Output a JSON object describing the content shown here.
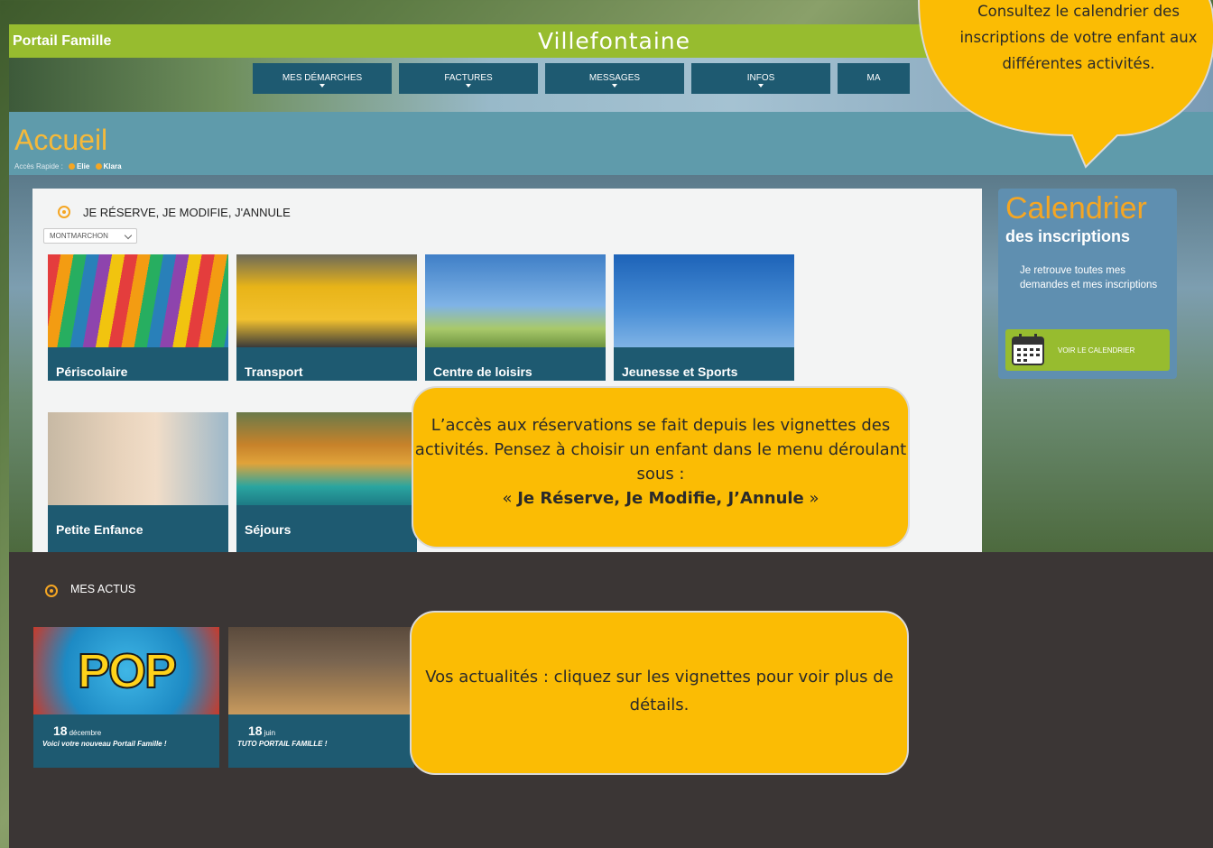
{
  "header": {
    "portal_title": "Portail Famille",
    "logo": "Villefontaine"
  },
  "nav": [
    {
      "label": "MES DÉMARCHES"
    },
    {
      "label": "FACTURES"
    },
    {
      "label": "MESSAGES"
    },
    {
      "label": "INFOS"
    },
    {
      "label": "MA"
    }
  ],
  "page": {
    "title": "Accueil",
    "quick_access_label": "Accès Rapide :",
    "children": [
      "Elie",
      "Klara"
    ]
  },
  "reservations": {
    "section_title": "JE RÉSERVE, JE MODIFIE, J'ANNULE",
    "selected_child": "MONTMARCHON",
    "tiles": [
      {
        "label": "Périscolaire",
        "icon": "colored-pencils-image"
      },
      {
        "label": "Transport",
        "icon": "school-bus-image"
      },
      {
        "label": "Centre de loisirs",
        "icon": "kids-jumping-image"
      },
      {
        "label": "Jeunesse et Sports",
        "icon": "football-player-image"
      },
      {
        "label": "Petite Enfance",
        "icon": "child-with-shell-image"
      },
      {
        "label": "Séjours",
        "icon": "autumn-lake-image"
      }
    ]
  },
  "calendar": {
    "title": "Calendrier",
    "subtitle": "des inscriptions",
    "description": "Je retrouve toutes mes demandes et mes inscriptions",
    "button_label": "VOIR LE CALENDRIER",
    "icon": "calendar-icon"
  },
  "actus": {
    "section_title": "MES ACTUS",
    "items": [
      {
        "day": "18",
        "month": "décembre",
        "caption": "Voici votre nouveau Portail Famille !",
        "image_text": "POP"
      },
      {
        "day": "18",
        "month": "juin",
        "caption": "TUTO PORTAIL FAMILLE !"
      }
    ]
  },
  "callouts": {
    "calendar_tip": "Consultez le calendrier des inscriptions de votre enfant aux différentes activités.",
    "reservation_tip_line1": "L’accès aux réservations se fait depuis les vignettes des activités. Pensez à choisir un enfant dans le menu déroulant sous :",
    "reservation_tip_quote_open": "« ",
    "reservation_tip_bold": "Je Réserve, Je Modifie, J’Annule",
    "reservation_tip_quote_close": " »",
    "actus_tip": "Vos actualités : cliquez sur les vignettes pour voir plus de détails."
  },
  "colors": {
    "header_green": "#97bc2f",
    "nav_blue": "#1e5a71",
    "accent_orange": "#f5a623",
    "callout_yellow": "#fbbc04",
    "actus_bg": "#3b3635"
  }
}
